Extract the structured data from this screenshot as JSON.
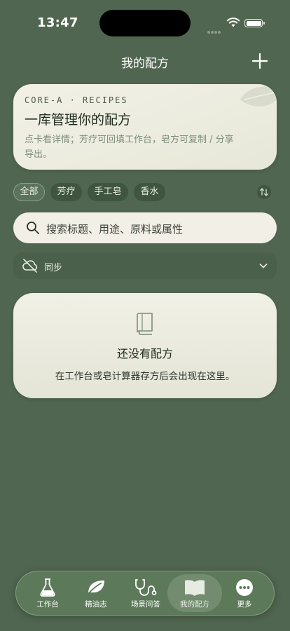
{
  "status_bar": {
    "time": "13:47"
  },
  "nav": {
    "title": "我的配方"
  },
  "hero": {
    "eyebrow": "CORE-A · RECIPES",
    "title": "一库管理你的配方",
    "subtitle": "点卡看详情；芳疗可回填工作台，皂方可复制 / 分享导出。"
  },
  "filters": {
    "chips": [
      {
        "label": "全部",
        "active": true
      },
      {
        "label": "芳疗",
        "active": false
      },
      {
        "label": "手工皂",
        "active": false
      },
      {
        "label": "香水",
        "active": false
      }
    ]
  },
  "search": {
    "placeholder": "搜索标题、用途、原料或属性"
  },
  "sync": {
    "label": "同步"
  },
  "empty_state": {
    "title": "还没有配方",
    "description": "在工作台或皂计算器存方后会出现在这里。"
  },
  "tabbar": {
    "items": [
      {
        "label": "工作台",
        "icon": "flask-icon"
      },
      {
        "label": "精油志",
        "icon": "leaf-icon"
      },
      {
        "label": "场景问答",
        "icon": "stethoscope-icon"
      },
      {
        "label": "我的配方",
        "icon": "open-book-icon",
        "active": true
      },
      {
        "label": "更多",
        "icon": "more-dots-icon"
      }
    ]
  },
  "colors": {
    "background": "#506650",
    "card": "#f2f0e6",
    "tabbar": "#5c7a59",
    "accent_text": "#7f8f7c"
  }
}
